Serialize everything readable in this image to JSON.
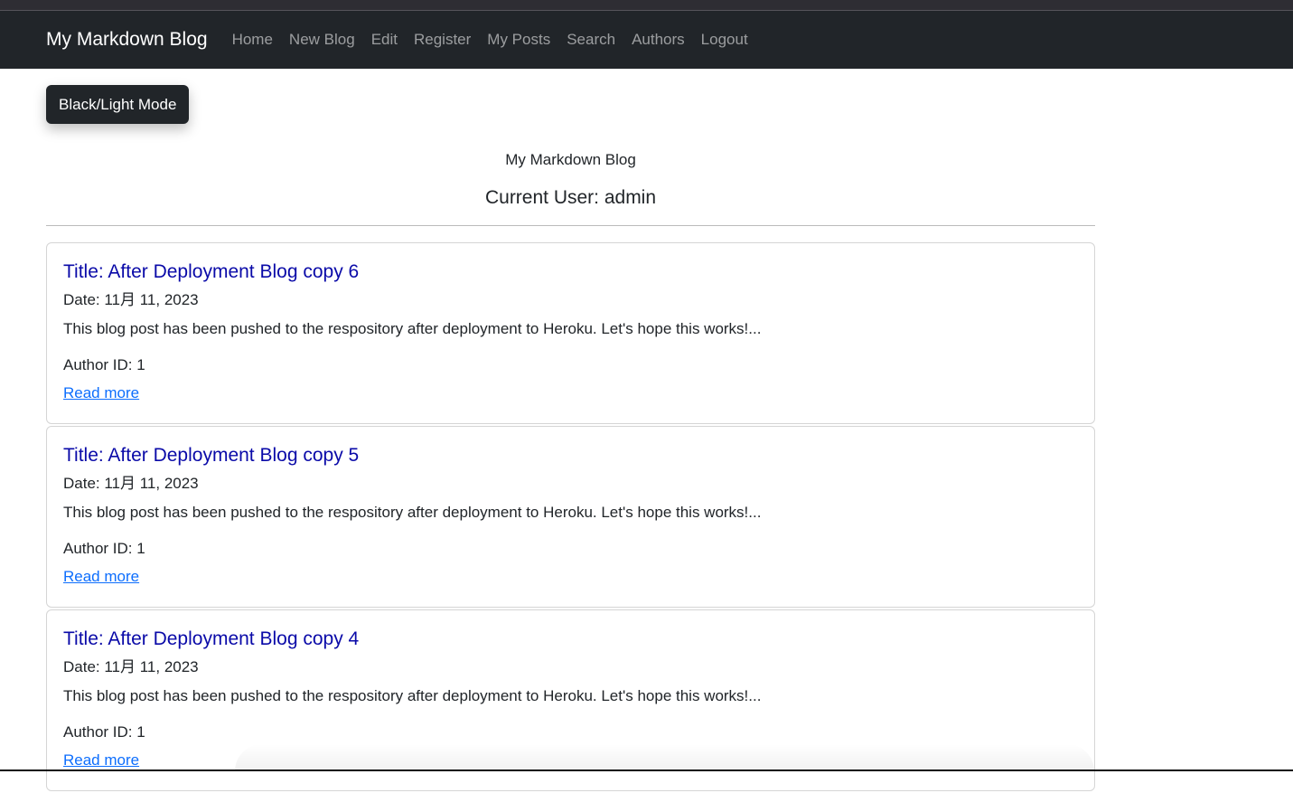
{
  "navbar": {
    "brand": "My Markdown Blog",
    "links": [
      "Home",
      "New Blog",
      "Edit",
      "Register",
      "My Posts",
      "Search",
      "Authors",
      "Logout"
    ]
  },
  "mode_button": "Black/Light Mode",
  "header": {
    "subtitle": "My Markdown Blog",
    "current_user": "Current User: admin"
  },
  "posts": [
    {
      "title": "Title: After Deployment Blog copy 6",
      "date": "Date: 11月 11, 2023",
      "excerpt": "This blog post has been pushed to the respository after deployment to Heroku. Let's hope this works!...",
      "author": "Author ID: 1",
      "link": "Read more"
    },
    {
      "title": "Title: After Deployment Blog copy 5",
      "date": "Date: 11月 11, 2023",
      "excerpt": "This blog post has been pushed to the respository after deployment to Heroku. Let's hope this works!...",
      "author": "Author ID: 1",
      "link": "Read more"
    },
    {
      "title": "Title: After Deployment Blog copy 4",
      "date": "Date: 11月 11, 2023",
      "excerpt": "This blog post has been pushed to the respository after deployment to Heroku. Let's hope this works!...",
      "author": "Author ID: 1",
      "link": "Read more"
    }
  ]
}
